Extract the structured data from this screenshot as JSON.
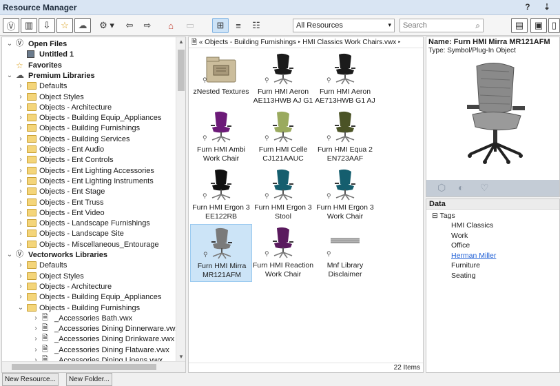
{
  "window": {
    "title": "Resource Manager",
    "controls": "? ⇣"
  },
  "toolbar": {
    "filter_select": "All Resources",
    "search_placeholder": "Search"
  },
  "tree": [
    {
      "label": "Open Files",
      "level": 0,
      "state": "open",
      "icon": "vectorworks-icon",
      "bold": true
    },
    {
      "label": "Untitled 1",
      "level": 1,
      "state": "none",
      "icon": "document-icon",
      "bold": true
    },
    {
      "label": "Favorites",
      "level": 0,
      "state": "none",
      "icon": "star-icon",
      "bold": true
    },
    {
      "label": "Premium Libraries",
      "level": 0,
      "state": "open",
      "icon": "cloud-icon",
      "bold": true
    },
    {
      "label": "Defaults",
      "level": 1,
      "state": "closed",
      "icon": "folder-icon"
    },
    {
      "label": "Object Styles",
      "level": 1,
      "state": "closed",
      "icon": "folder-icon"
    },
    {
      "label": "Objects - Architecture",
      "level": 1,
      "state": "closed",
      "icon": "folder-icon"
    },
    {
      "label": "Objects - Building Equip_Appliances",
      "level": 1,
      "state": "closed",
      "icon": "folder-icon"
    },
    {
      "label": "Objects - Building Furnishings",
      "level": 1,
      "state": "closed",
      "icon": "folder-icon"
    },
    {
      "label": "Objects - Building Services",
      "level": 1,
      "state": "closed",
      "icon": "folder-icon"
    },
    {
      "label": "Objects - Ent Audio",
      "level": 1,
      "state": "closed",
      "icon": "folder-icon"
    },
    {
      "label": "Objects - Ent Controls",
      "level": 1,
      "state": "closed",
      "icon": "folder-icon"
    },
    {
      "label": "Objects - Ent Lighting Accessories",
      "level": 1,
      "state": "closed",
      "icon": "folder-icon"
    },
    {
      "label": "Objects - Ent Lighting Instruments",
      "level": 1,
      "state": "closed",
      "icon": "folder-icon"
    },
    {
      "label": "Objects - Ent Stage",
      "level": 1,
      "state": "closed",
      "icon": "folder-icon"
    },
    {
      "label": "Objects - Ent Truss",
      "level": 1,
      "state": "closed",
      "icon": "folder-icon"
    },
    {
      "label": "Objects - Ent Video",
      "level": 1,
      "state": "closed",
      "icon": "folder-icon"
    },
    {
      "label": "Objects - Landscape Furnishings",
      "level": 1,
      "state": "closed",
      "icon": "folder-icon"
    },
    {
      "label": "Objects - Landscape Site",
      "level": 1,
      "state": "closed",
      "icon": "folder-icon"
    },
    {
      "label": "Objects - Miscellaneous_Entourage",
      "level": 1,
      "state": "closed",
      "icon": "folder-icon"
    },
    {
      "label": "Vectorworks Libraries",
      "level": 0,
      "state": "open",
      "icon": "vectorworks-icon",
      "bold": true
    },
    {
      "label": "Defaults",
      "level": 1,
      "state": "closed",
      "icon": "folder-icon"
    },
    {
      "label": "Object Styles",
      "level": 1,
      "state": "closed",
      "icon": "folder-icon"
    },
    {
      "label": "Objects - Architecture",
      "level": 1,
      "state": "closed",
      "icon": "folder-icon"
    },
    {
      "label": "Objects - Building Equip_Appliances",
      "level": 1,
      "state": "closed",
      "icon": "folder-icon"
    },
    {
      "label": "Objects - Building Furnishings",
      "level": 1,
      "state": "open",
      "icon": "folder-icon"
    },
    {
      "label": "_Accessories Bath.vwx",
      "level": 2,
      "state": "closed",
      "icon": "file-icon"
    },
    {
      "label": "_Accessories Dining Dinnerware.vwx",
      "level": 2,
      "state": "closed",
      "icon": "file-icon"
    },
    {
      "label": "_Accessories Dining Drinkware.vwx",
      "level": 2,
      "state": "closed",
      "icon": "file-icon"
    },
    {
      "label": "_Accessories Dining Flatware.vwx",
      "level": 2,
      "state": "closed",
      "icon": "file-icon"
    },
    {
      "label": "_Accessories Dining Linens.vwx",
      "level": 2,
      "state": "closed",
      "icon": "file-icon"
    }
  ],
  "breadcrumb": {
    "back": "«",
    "segments": [
      "Objects - Building Furnishings",
      "HMI Classics Work Chairs.vwx"
    ]
  },
  "grid": [
    {
      "label": "zNested Textures",
      "kind": "folder"
    },
    {
      "label": "Furn HMI Aeron AE113HWB AJ G1",
      "kind": "chair",
      "color": "#1b1b1b"
    },
    {
      "label": "Furn HMI Aeron AE713HWB G1 AJ",
      "kind": "chair",
      "color": "#1b1b1b"
    },
    {
      "label": "Furn HMI Ambi Work Chair",
      "kind": "chair",
      "color": "#6c1a78"
    },
    {
      "label": "Furn HMI Celle CJ121AAUC",
      "kind": "chair",
      "color": "#9aaa5e"
    },
    {
      "label": "Furn HMI Equa 2 EN723AAF",
      "kind": "chair",
      "color": "#4b5326"
    },
    {
      "label": "Furn HMI Ergon 3 EE122RB",
      "kind": "chair",
      "color": "#111111"
    },
    {
      "label": "Furn HMI Ergon 3 Stool",
      "kind": "chair",
      "color": "#155e6e"
    },
    {
      "label": "Furn HMI Ergon 3 Work Chair",
      "kind": "chair",
      "color": "#155e6e"
    },
    {
      "label": "Furn HMI Mirra MR121AFM",
      "kind": "chair",
      "color": "#7a7a7a",
      "selected": true
    },
    {
      "label": "Furn HMI Reaction Work Chair",
      "kind": "chair",
      "color": "#5a1a5e"
    },
    {
      "label": "Mnf Library Disclaimer",
      "kind": "disclaimer"
    }
  ],
  "status": {
    "count": "22 Items"
  },
  "preview": {
    "name": "Name: Furn HMI Mirra MR121AFM",
    "type": "Type: Symbol/Plug-In Object"
  },
  "data_panel": {
    "header": "Data",
    "root": "Tags",
    "tags": [
      "HMI Classics",
      "Work",
      "Office",
      "Herman Miller",
      "Furniture",
      "Seating"
    ],
    "link_tag": "Herman Miller"
  },
  "bottom": {
    "new_resource": "New Resource...",
    "new_folder": "New Folder..."
  },
  "colors": {
    "titlebar": "#d9e5f3",
    "selection": "#cce4f7",
    "link": "#1f5fd6",
    "folder": "#f4d57a"
  }
}
